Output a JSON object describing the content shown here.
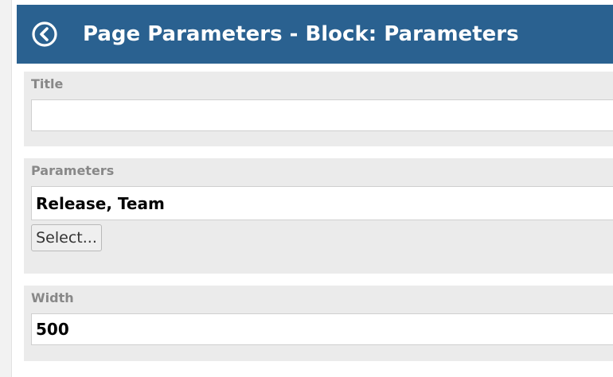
{
  "header": {
    "title": "Page Parameters - Block: Parameters",
    "back_icon": "back-circle-icon",
    "color": "#2a6190"
  },
  "fields": {
    "title": {
      "label": "Title",
      "value": ""
    },
    "parameters": {
      "label": "Parameters",
      "value": "Release, Team",
      "select_label": "Select..."
    },
    "width": {
      "label": "Width",
      "value": "500"
    }
  }
}
